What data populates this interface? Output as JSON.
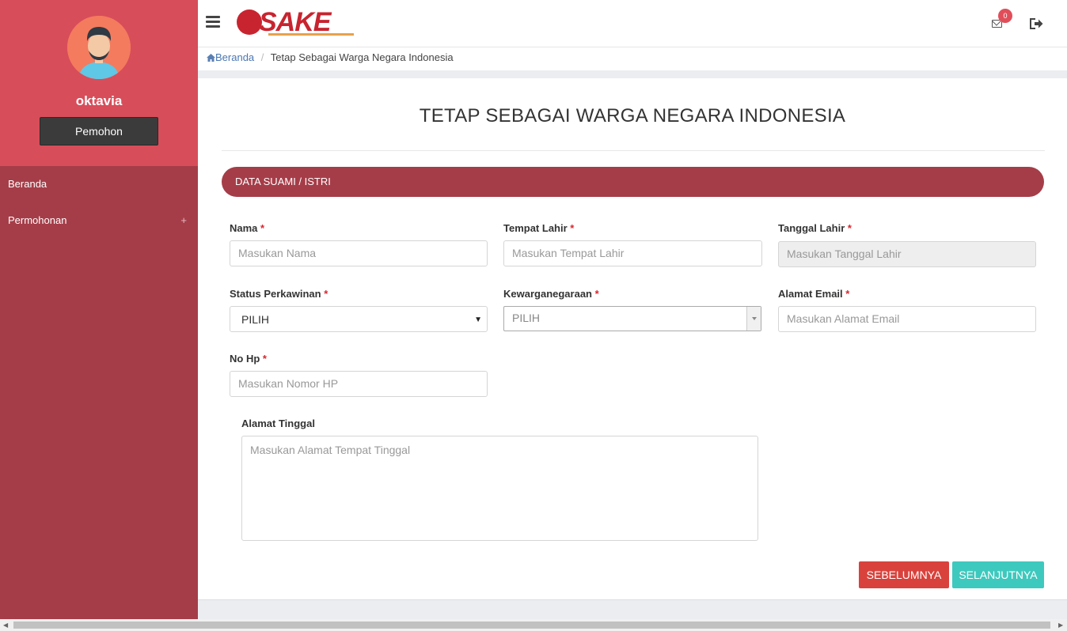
{
  "sidebar": {
    "username": "oktavia",
    "role": "Pemohon",
    "items": [
      {
        "label": "Beranda"
      },
      {
        "label": "Permohonan",
        "expand": "+"
      }
    ]
  },
  "header": {
    "logo_text": "SAKE",
    "notification_count": "0"
  },
  "breadcrumb": {
    "home": "Beranda",
    "separator": "/",
    "current": "Tetap Sebagai Warga Negara Indonesia"
  },
  "page": {
    "title": "TETAP SEBAGAI WARGA NEGARA INDONESIA",
    "section": "DATA SUAMI / ISTRI"
  },
  "form": {
    "nama": {
      "label": "Nama",
      "required": "*",
      "placeholder": "Masukan Nama"
    },
    "tempat_lahir": {
      "label": "Tempat Lahir",
      "required": "*",
      "placeholder": "Masukan Tempat Lahir"
    },
    "tanggal_lahir": {
      "label": "Tanggal Lahir",
      "required": "*",
      "placeholder": "Masukan Tanggal Lahir"
    },
    "status_perkawinan": {
      "label": "Status Perkawinan",
      "required": "*",
      "value": "PILIH"
    },
    "kewarganegaraan": {
      "label": "Kewarganegaraan",
      "required": "*",
      "value": "PILIH"
    },
    "alamat_email": {
      "label": "Alamat Email",
      "required": "*",
      "placeholder": "Masukan Alamat Email"
    },
    "no_hp": {
      "label": "No Hp",
      "required": "*",
      "placeholder": "Masukan Nomor HP"
    },
    "alamat_tinggal": {
      "label": "Alamat Tinggal",
      "placeholder": "Masukan Alamat Tempat Tinggal"
    }
  },
  "actions": {
    "prev": "SEBELUMNYA",
    "next": "SELANJUTNYA"
  },
  "colors": {
    "sidebar": "#a53d48",
    "profile": "#d84d5a",
    "section_bar": "#a53d48",
    "btn_prev": "#d9423c",
    "btn_next": "#3ec9be"
  }
}
